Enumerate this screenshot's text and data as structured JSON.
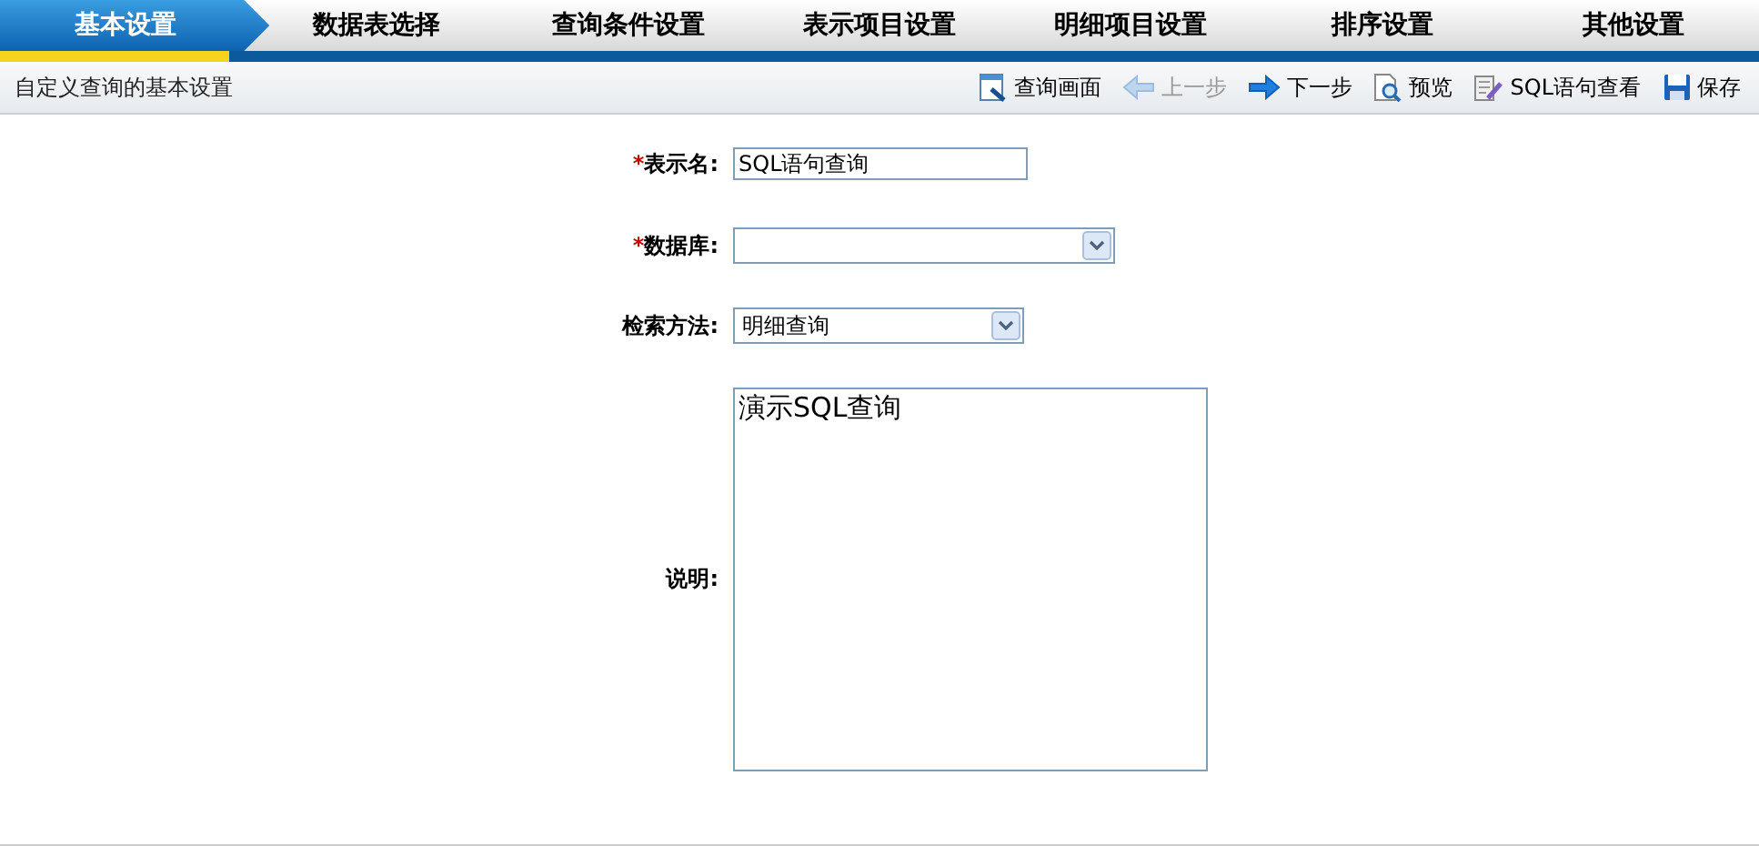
{
  "tabs": [
    {
      "label": "基本设置",
      "selected": true
    },
    {
      "label": "数据表选择",
      "selected": false
    },
    {
      "label": "查询条件设置",
      "selected": false
    },
    {
      "label": "表示项目设置",
      "selected": false
    },
    {
      "label": "明细项目设置",
      "selected": false
    },
    {
      "label": "排序设置",
      "selected": false
    },
    {
      "label": "其他设置",
      "selected": false
    }
  ],
  "subtitle": "自定义查询的基本设置",
  "toolbar": [
    {
      "kind": "screen",
      "label": "查询画面",
      "disabled": false
    },
    {
      "kind": "prev",
      "label": "上一步",
      "disabled": true
    },
    {
      "kind": "next",
      "label": "下一步",
      "disabled": false
    },
    {
      "kind": "preview",
      "label": "预览",
      "disabled": false
    },
    {
      "kind": "sql",
      "label": "SQL语句查看",
      "disabled": false
    },
    {
      "kind": "save",
      "label": "保存",
      "disabled": false
    }
  ],
  "form": [
    {
      "kind": "text",
      "label": "表示名:",
      "required_mark": "*",
      "value": "SQL语句查询"
    },
    {
      "kind": "select",
      "label": "数据库:",
      "required_mark": "*"
    },
    {
      "kind": "select",
      "label": "检索方法:",
      "value": "明细查询"
    },
    {
      "kind": "textarea",
      "label": "说明:",
      "value": "演示SQL查询"
    }
  ]
}
